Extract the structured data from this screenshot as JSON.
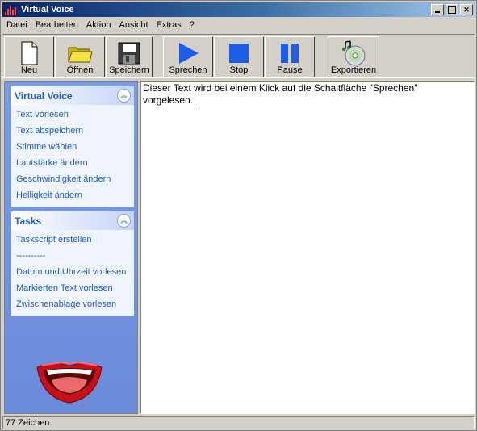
{
  "window": {
    "title": "Virtual Voice"
  },
  "menu": [
    "Datei",
    "Bearbeiten",
    "Aktion",
    "Ansicht",
    "Extras",
    "?"
  ],
  "toolbar": {
    "new": "Neu",
    "open": "Öffnen",
    "save": "Speichern",
    "speak": "Sprechen",
    "stop": "Stop",
    "pause": "Pause",
    "export": "Exportieren"
  },
  "sidebar": {
    "panel1": {
      "title": "Virtual Voice",
      "links": [
        "Text vorlesen",
        "Text abspeichern",
        "Stimme wählen",
        "Lautstärke ändern",
        "Geschwindigkeit ändern",
        "Helligkeit ändern"
      ]
    },
    "panel2": {
      "title": "Tasks",
      "links": [
        "Taskscript erstellen",
        "----------",
        "Datum und Uhrzeit vorlesen",
        "Markierten Text vorlesen",
        "Zwischenablage vorlesen"
      ]
    }
  },
  "editor": {
    "text": "Dieser Text wird bei einem Klick auf die Schaltfläche \"Sprechen\"\nvorgelesen."
  },
  "status": {
    "text": "77 Zeichen."
  },
  "colors": {
    "link": "#215dc6",
    "sidebar_bg": "#6b8bd9",
    "title_bar": "#0a246a",
    "play_blue": "#1e5ee6"
  },
  "icons": [
    "window-minimize-icon",
    "window-maximize-icon",
    "window-close-icon",
    "new-document-icon",
    "folder-icon",
    "floppy-disk-icon",
    "play-icon",
    "stop-icon",
    "pause-icon",
    "cd-music-icon",
    "chevron-up-icon",
    "mouth-logo"
  ]
}
